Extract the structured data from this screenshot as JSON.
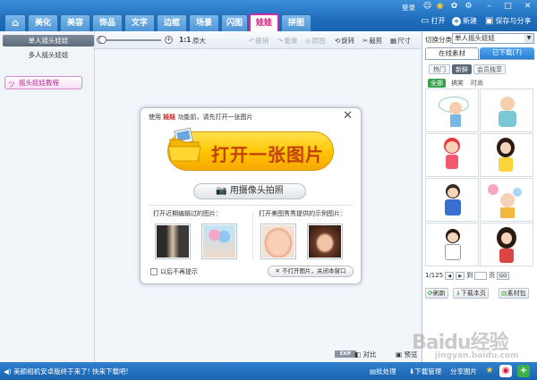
{
  "topbar": {
    "tabs": [
      {
        "label": "⌂",
        "name": "home"
      },
      {
        "label": "美化",
        "name": "beautify"
      },
      {
        "label": "美容",
        "name": "cosmetic"
      },
      {
        "label": "饰品",
        "name": "accessory"
      },
      {
        "label": "文字",
        "name": "text"
      },
      {
        "label": "边框",
        "name": "frame"
      },
      {
        "label": "场景",
        "name": "scene"
      },
      {
        "label": "闪图",
        "name": "flash"
      },
      {
        "label": "娃娃",
        "name": "doll"
      },
      {
        "label": "拼图",
        "name": "collage"
      }
    ],
    "active_tab": "娃娃",
    "login_label": "登录",
    "open_label": "打开",
    "new_label": "新建",
    "save_share_label": "保存与分享"
  },
  "leftcol": {
    "modes": [
      "单人摇头娃娃",
      "多人摇头娃娃"
    ],
    "selected_mode": "单人摇头娃娃",
    "tutorial_label": "摇头娃娃教程"
  },
  "toolbar": {
    "zoom_ratio": "1:1",
    "original_label": "原大",
    "undo_label": "撤销",
    "redo_label": "重做",
    "reset_label": "原图",
    "rotate_label": "旋转",
    "crop_label": "裁剪",
    "resize_label": "尺寸"
  },
  "dialog": {
    "hint_prefix": "使用",
    "hint_highlight": "娃娃",
    "hint_suffix": "功能前，请先打开一张图片",
    "open_label": "打开一张图片",
    "camera_label": "用摄像头拍照",
    "recent_label": "打开近期编辑过的图片：",
    "sample_label": "打开美图秀秀提供的示例图片：",
    "no_remind_label": "以后不再提示",
    "no_open_label": "不打开图片，关闭本窗口"
  },
  "canvas_footer": {
    "compare_badge": "EXIF",
    "compare_label": "对比",
    "preview_label": "预览"
  },
  "rpanel": {
    "category_label": "切换分类",
    "category_value": "单人摇头娃娃",
    "tab_online": "在线素材",
    "tab_downloaded": "已下载(7)",
    "subtabs": [
      "热门",
      "新鲜",
      "会员独享"
    ],
    "active_subtab": "新鲜",
    "filters": [
      "全部",
      "搞笑",
      "时尚"
    ],
    "active_filter": "全部",
    "page_label": "1/125",
    "page_to_label": "到",
    "page_unit_label": "页",
    "go_label": "GO",
    "refresh_label": "刷新",
    "download_page_label": "下载本页",
    "pack_label": "素材包"
  },
  "bottombar": {
    "notice": "美颜相机安卓版终于来了! 快来下载吧!",
    "batch_label": "批处理",
    "download_mgr_label": "下载管理",
    "share_label": "分享图片"
  },
  "watermark": {
    "text": "Baidu经验",
    "sub": "jingyan.baidu.com"
  },
  "colors": {
    "topbar": "#1e6ebd",
    "active_tab_border": "#d02aa0",
    "open_button": "#ffc400",
    "accent_green": "#35a14b"
  }
}
